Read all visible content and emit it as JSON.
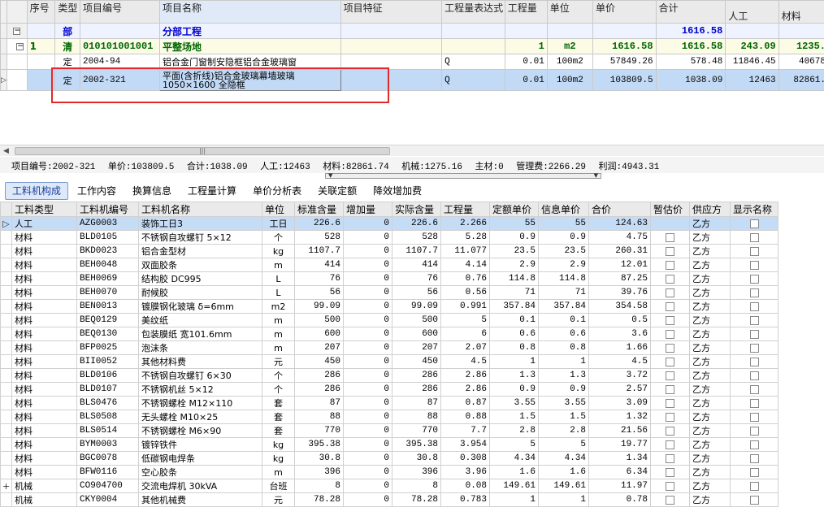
{
  "top_grid": {
    "headers": [
      "序号",
      "类型",
      "项目编号",
      "项目名称",
      "项目特征",
      "工程量表达式",
      "工程量",
      "单位",
      "单价",
      "合计",
      "人工",
      "材料"
    ],
    "rows": [
      {
        "kind": "sum",
        "tree": "−",
        "seq": "",
        "type": "部",
        "code": "",
        "name": "分部工程",
        "feature": "",
        "expr": "",
        "qty": "",
        "unit": "",
        "price": "",
        "total": "1616.58",
        "labor": "",
        "material": ""
      },
      {
        "kind": "item",
        "tree": "−",
        "seq": "1",
        "type": "清",
        "code": "010101001001",
        "name": "平整场地",
        "feature": "",
        "expr": "",
        "qty": "1",
        "unit": "m2",
        "price": "1616.58",
        "total": "1616.58",
        "labor": "243.09",
        "material": "1235."
      },
      {
        "kind": "ding",
        "tree": "",
        "seq": "",
        "type": "定",
        "code": "2004-94",
        "name": "铝合金门窗制安隐框铝合金玻璃窗",
        "feature": "",
        "expr": "Q",
        "qty": "0.01",
        "unit": "100m2",
        "price": "57849.26",
        "total": "578.48",
        "labor": "11846.45",
        "material": "40678"
      },
      {
        "kind": "sel",
        "tree": "",
        "seq": "",
        "type": "定",
        "code": "2002-321",
        "name": "平面(含折线)铝合金玻璃幕墙玻璃1050×1600 全隐框",
        "feature": "",
        "expr": "Q",
        "qty": "0.01",
        "unit": "100m2",
        "price": "103809.5",
        "total": "1038.09",
        "labor": "12463",
        "material": "82861."
      }
    ]
  },
  "info_bar": {
    "code": "项目编号:2002-321",
    "price": "单价:103809.5",
    "total": "合计:1038.09",
    "labor": "人工:12463",
    "material": "材料:82861.74",
    "machine": "机械:1275.16",
    "main_mat": "主材:0",
    "mgmt": "管理费:2266.29",
    "profit": "利润:4943.31"
  },
  "tabs": [
    "工料机构成",
    "工作内容",
    "换算信息",
    "工程量计算",
    "单价分析表",
    "关联定额",
    "降效增加费"
  ],
  "bottom_grid": {
    "headers": [
      "工料类型",
      "工料机编号",
      "工料机名称",
      "单位",
      "标准含量",
      "增加量",
      "实际含量",
      "工程量",
      "定额单价",
      "信息单价",
      "合价",
      "暂估价",
      "供应方",
      "显示名称"
    ],
    "rows": [
      {
        "mark": "▷",
        "type": "人工",
        "code": "AZG0003",
        "name": "装饰工日3",
        "unit": "工日",
        "std": "226.6",
        "add": "0",
        "act": "226.6",
        "qty": "2.266",
        "dprice": "55",
        "iprice": "55",
        "total": "124.63",
        "supplier": "乙方"
      },
      {
        "mark": "",
        "type": "材料",
        "code": "BLD0105",
        "name": "不锈钢自攻螺钉 5×12",
        "unit": "个",
        "std": "528",
        "add": "0",
        "act": "528",
        "qty": "5.28",
        "dprice": "0.9",
        "iprice": "0.9",
        "total": "4.75",
        "supplier": "乙方"
      },
      {
        "mark": "",
        "type": "材料",
        "code": "BKD0023",
        "name": "铝合金型材",
        "unit": "kg",
        "std": "1107.7",
        "add": "0",
        "act": "1107.7",
        "qty": "11.077",
        "dprice": "23.5",
        "iprice": "23.5",
        "total": "260.31",
        "supplier": "乙方"
      },
      {
        "mark": "",
        "type": "材料",
        "code": "BEH0048",
        "name": "双面胶条",
        "unit": "m",
        "std": "414",
        "add": "0",
        "act": "414",
        "qty": "4.14",
        "dprice": "2.9",
        "iprice": "2.9",
        "total": "12.01",
        "supplier": "乙方"
      },
      {
        "mark": "",
        "type": "材料",
        "code": "BEH0069",
        "name": "结构胶 DC995",
        "unit": "L",
        "std": "76",
        "add": "0",
        "act": "76",
        "qty": "0.76",
        "dprice": "114.8",
        "iprice": "114.8",
        "total": "87.25",
        "supplier": "乙方"
      },
      {
        "mark": "",
        "type": "材料",
        "code": "BEH0070",
        "name": "耐候胶",
        "unit": "L",
        "std": "56",
        "add": "0",
        "act": "56",
        "qty": "0.56",
        "dprice": "71",
        "iprice": "71",
        "total": "39.76",
        "supplier": "乙方"
      },
      {
        "mark": "",
        "type": "材料",
        "code": "BEN0013",
        "name": "镀膜钢化玻璃 δ=6mm",
        "unit": "m2",
        "std": "99.09",
        "add": "0",
        "act": "99.09",
        "qty": "0.991",
        "dprice": "357.84",
        "iprice": "357.84",
        "total": "354.58",
        "supplier": "乙方"
      },
      {
        "mark": "",
        "type": "材料",
        "code": "BEQ0129",
        "name": "美纹纸",
        "unit": "m",
        "std": "500",
        "add": "0",
        "act": "500",
        "qty": "5",
        "dprice": "0.1",
        "iprice": "0.1",
        "total": "0.5",
        "supplier": "乙方"
      },
      {
        "mark": "",
        "type": "材料",
        "code": "BEQ0130",
        "name": "包装膜纸 宽101.6mm",
        "unit": "m",
        "std": "600",
        "add": "0",
        "act": "600",
        "qty": "6",
        "dprice": "0.6",
        "iprice": "0.6",
        "total": "3.6",
        "supplier": "乙方"
      },
      {
        "mark": "",
        "type": "材料",
        "code": "BFP0025",
        "name": "泡沫条",
        "unit": "m",
        "std": "207",
        "add": "0",
        "act": "207",
        "qty": "2.07",
        "dprice": "0.8",
        "iprice": "0.8",
        "total": "1.66",
        "supplier": "乙方"
      },
      {
        "mark": "",
        "type": "材料",
        "code": "BII0052",
        "name": "其他材料费",
        "unit": "元",
        "std": "450",
        "add": "0",
        "act": "450",
        "qty": "4.5",
        "dprice": "1",
        "iprice": "1",
        "total": "4.5",
        "supplier": "乙方"
      },
      {
        "mark": "",
        "type": "材料",
        "code": "BLD0106",
        "name": "不锈钢自攻螺钉 6×30",
        "unit": "个",
        "std": "286",
        "add": "0",
        "act": "286",
        "qty": "2.86",
        "dprice": "1.3",
        "iprice": "1.3",
        "total": "3.72",
        "supplier": "乙方"
      },
      {
        "mark": "",
        "type": "材料",
        "code": "BLD0107",
        "name": "不锈钢机丝 5×12",
        "unit": "个",
        "std": "286",
        "add": "0",
        "act": "286",
        "qty": "2.86",
        "dprice": "0.9",
        "iprice": "0.9",
        "total": "2.57",
        "supplier": "乙方"
      },
      {
        "mark": "",
        "type": "材料",
        "code": "BLS0476",
        "name": "不锈钢螺栓 M12×110",
        "unit": "套",
        "std": "87",
        "add": "0",
        "act": "87",
        "qty": "0.87",
        "dprice": "3.55",
        "iprice": "3.55",
        "total": "3.09",
        "supplier": "乙方"
      },
      {
        "mark": "",
        "type": "材料",
        "code": "BLS0508",
        "name": "无头螺栓 M10×25",
        "unit": "套",
        "std": "88",
        "add": "0",
        "act": "88",
        "qty": "0.88",
        "dprice": "1.5",
        "iprice": "1.5",
        "total": "1.32",
        "supplier": "乙方"
      },
      {
        "mark": "",
        "type": "材料",
        "code": "BLS0514",
        "name": "不锈钢螺栓 M6×90",
        "unit": "套",
        "std": "770",
        "add": "0",
        "act": "770",
        "qty": "7.7",
        "dprice": "2.8",
        "iprice": "2.8",
        "total": "21.56",
        "supplier": "乙方"
      },
      {
        "mark": "",
        "type": "材料",
        "code": "BYM0003",
        "name": "镀锌铁件",
        "unit": "kg",
        "std": "395.38",
        "add": "0",
        "act": "395.38",
        "qty": "3.954",
        "dprice": "5",
        "iprice": "5",
        "total": "19.77",
        "supplier": "乙方"
      },
      {
        "mark": "",
        "type": "材料",
        "code": "BGC0078",
        "name": "低碳钢电焊条",
        "unit": "kg",
        "std": "30.8",
        "add": "0",
        "act": "30.8",
        "qty": "0.308",
        "dprice": "4.34",
        "iprice": "4.34",
        "total": "1.34",
        "supplier": "乙方"
      },
      {
        "mark": "",
        "type": "材料",
        "code": "BFW0116",
        "name": "空心胶条",
        "unit": "m",
        "std": "396",
        "add": "0",
        "act": "396",
        "qty": "3.96",
        "dprice": "1.6",
        "iprice": "1.6",
        "total": "6.34",
        "supplier": "乙方"
      },
      {
        "mark": "+",
        "type": "机械",
        "code": "CO904700",
        "name": "交流电焊机 30kVA",
        "unit": "台班",
        "std": "8",
        "add": "0",
        "act": "8",
        "qty": "0.08",
        "dprice": "149.61",
        "iprice": "149.61",
        "total": "11.97",
        "supplier": "乙方"
      },
      {
        "mark": "",
        "type": "机械",
        "code": "CKY0004",
        "name": "其他机械费",
        "unit": "元",
        "std": "78.28",
        "add": "0",
        "act": "78.28",
        "qty": "0.783",
        "dprice": "1",
        "iprice": "1",
        "total": "0.78",
        "supplier": "乙方"
      }
    ]
  }
}
